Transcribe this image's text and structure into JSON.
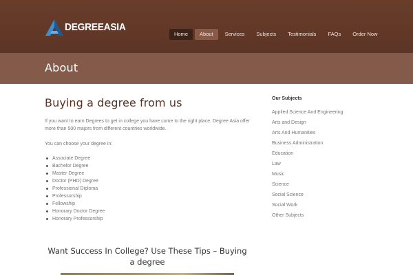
{
  "logo": {
    "text_main": "DEGREE",
    "text_accent": "ASIA",
    "icon": "logo-a-icon",
    "colors": {
      "blue": "#3b8fd6",
      "dark": "#1f5a8e"
    }
  },
  "nav": {
    "items": [
      "Home",
      "About",
      "Services",
      "Subjects",
      "Testimonials",
      "FAQs",
      "Order Now"
    ],
    "active": "About"
  },
  "page": {
    "title": "About"
  },
  "main": {
    "heading": "Buying a degree from us",
    "intro": "If you want to earn Degrees to get in college you have come to the right place.  Degree Asia offer more than 500 majors from different countries worldwide.",
    "choose": "You can choose your degree in:",
    "degrees": [
      "Associate Degree",
      "Bachelor Degree",
      "Master Degree",
      "Doctor (PHD) Degree",
      "Professional Diploma",
      "Professorship",
      "Fellowship",
      "Honorary Doctor Degree",
      "Honorary Professorship"
    ],
    "post_title": "Want Success In College? Use These Tips – Buying a degree"
  },
  "sidebar": {
    "heading": "Our Subjects",
    "subjects": [
      "Applied Science And Engineering",
      "Arts and Design",
      "Arts And Humanities",
      "Business Administration",
      "Education",
      "Law",
      "Music",
      "Science",
      "Social Science",
      "Social Work",
      "Other Subjects"
    ]
  },
  "colors": {
    "header_bg": "#5c3526",
    "title_bar_bg": "#845b4b",
    "heading_brown": "#5a3324",
    "nav_home_bg": "#3c2319",
    "nav_active_bg": "#8a5a48"
  }
}
